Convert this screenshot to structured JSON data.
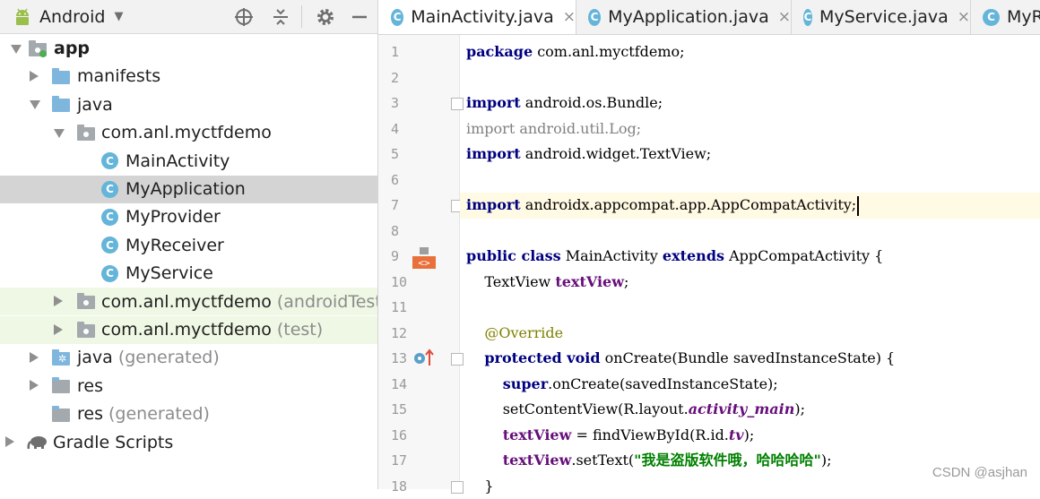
{
  "project_panel": {
    "view_selector": {
      "label": "Android",
      "icon": "android-icon"
    },
    "toolbar_icons": [
      "crosshair-icon",
      "collapse-all-icon",
      "gear-icon",
      "minimize-icon"
    ],
    "tree": [
      {
        "label": "app",
        "suffix": "",
        "icon": "module-icon",
        "arrow": "down",
        "bold": true
      },
      {
        "label": "manifests",
        "suffix": "",
        "icon": "folder-icon",
        "arrow": "right"
      },
      {
        "label": "java",
        "suffix": "",
        "icon": "folder-icon",
        "arrow": "down"
      },
      {
        "label": "com.anl.myctfdemo",
        "suffix": "",
        "icon": "package-icon",
        "arrow": "down"
      },
      {
        "label": "MainActivity",
        "suffix": "",
        "icon": "class-icon",
        "arrow": ""
      },
      {
        "label": "MyApplication",
        "suffix": "",
        "icon": "class-icon",
        "arrow": "",
        "selected": true
      },
      {
        "label": "MyProvider",
        "suffix": "",
        "icon": "class-icon",
        "arrow": ""
      },
      {
        "label": "MyReceiver",
        "suffix": "",
        "icon": "class-icon",
        "arrow": ""
      },
      {
        "label": "MyService",
        "suffix": "",
        "icon": "class-icon",
        "arrow": ""
      },
      {
        "label": "com.anl.myctfdemo",
        "suffix": "(androidTest)",
        "icon": "package-icon",
        "arrow": "right",
        "green": true
      },
      {
        "label": "com.anl.myctfdemo",
        "suffix": "(test)",
        "icon": "package-icon",
        "arrow": "right",
        "green": true
      },
      {
        "label": "java",
        "suffix": "(generated)",
        "icon": "generated-folder-icon",
        "arrow": "right"
      },
      {
        "label": "res",
        "suffix": "",
        "icon": "resources-folder-icon",
        "arrow": "right"
      },
      {
        "label": "res",
        "suffix": "(generated)",
        "icon": "resources-folder-icon",
        "arrow": ""
      },
      {
        "label": "Gradle Scripts",
        "suffix": "",
        "icon": "gradle-elephant-icon",
        "arrow": "right"
      }
    ]
  },
  "editor": {
    "tabs": [
      {
        "label": "MainActivity.java",
        "active": true,
        "close": "×"
      },
      {
        "label": "MyApplication.java",
        "active": false,
        "close": "×"
      },
      {
        "label": "MyService.java",
        "active": false,
        "close": "×"
      },
      {
        "label": "MyR",
        "active": false,
        "close": ""
      }
    ],
    "class_icon_letter": "C",
    "line_numbers": [
      "1",
      "2",
      "3",
      "4",
      "5",
      "6",
      "7",
      "8",
      "9",
      "10",
      "11",
      "12",
      "13",
      "14",
      "15",
      "16",
      "17",
      "18"
    ],
    "code_lines": [
      {
        "tokens": [
          {
            "t": "package",
            "c": "kw"
          },
          {
            "t": " com.anl.myctfdemo;",
            "c": ""
          }
        ]
      },
      {
        "tokens": []
      },
      {
        "tokens": [
          {
            "t": "import",
            "c": "kw"
          },
          {
            "t": " android.os.Bundle;",
            "c": ""
          }
        ]
      },
      {
        "tokens": [
          {
            "t": "import android.util.Log;",
            "c": "dim"
          }
        ]
      },
      {
        "tokens": [
          {
            "t": "import",
            "c": "kw"
          },
          {
            "t": " android.widget.TextView;",
            "c": ""
          }
        ]
      },
      {
        "tokens": []
      },
      {
        "tokens": [
          {
            "t": "import",
            "c": "kw"
          },
          {
            "t": " androidx.appcompat.app.AppCompatActivity;",
            "c": ""
          }
        ],
        "current": true
      },
      {
        "tokens": []
      },
      {
        "tokens": [
          {
            "t": "public class",
            "c": "kw"
          },
          {
            "t": " MainActivity ",
            "c": ""
          },
          {
            "t": "extends",
            "c": "kw"
          },
          {
            "t": " AppCompatActivity {",
            "c": ""
          }
        ]
      },
      {
        "tokens": [
          {
            "t": "    TextView ",
            "c": ""
          },
          {
            "t": "textView",
            "c": "fld"
          },
          {
            "t": ";",
            "c": ""
          }
        ]
      },
      {
        "tokens": []
      },
      {
        "tokens": [
          {
            "t": "    @Override",
            "c": "ann"
          }
        ]
      },
      {
        "tokens": [
          {
            "t": "    ",
            "c": ""
          },
          {
            "t": "protected void",
            "c": "kw"
          },
          {
            "t": " onCreate(Bundle savedInstanceState) {",
            "c": ""
          }
        ]
      },
      {
        "tokens": [
          {
            "t": "        ",
            "c": ""
          },
          {
            "t": "super",
            "c": "kw"
          },
          {
            "t": ".onCreate(savedInstanceState);",
            "c": ""
          }
        ]
      },
      {
        "tokens": [
          {
            "t": "        setContentView(R.layout.",
            "c": ""
          },
          {
            "t": "activity_main",
            "c": "fldi"
          },
          {
            "t": ");",
            "c": ""
          }
        ]
      },
      {
        "tokens": [
          {
            "t": "        ",
            "c": ""
          },
          {
            "t": "textView",
            "c": "fld"
          },
          {
            "t": " = findViewById(R.id.",
            "c": ""
          },
          {
            "t": "tv",
            "c": "fldi"
          },
          {
            "t": ");",
            "c": ""
          }
        ]
      },
      {
        "tokens": [
          {
            "t": "        ",
            "c": ""
          },
          {
            "t": "textView",
            "c": "fld"
          },
          {
            "t": ".setText(",
            "c": ""
          },
          {
            "t": "\"我是盗版软件哦，哈哈哈哈\"",
            "c": "str"
          },
          {
            "t": ");",
            "c": ""
          }
        ]
      },
      {
        "tokens": [
          {
            "t": "    }",
            "c": ""
          }
        ]
      }
    ],
    "gutter_icons": [
      {
        "line": 9,
        "name": "layout-file-icon"
      },
      {
        "line": 13,
        "name": "override-method-icon"
      }
    ]
  },
  "watermark": "CSDN @asjhan"
}
